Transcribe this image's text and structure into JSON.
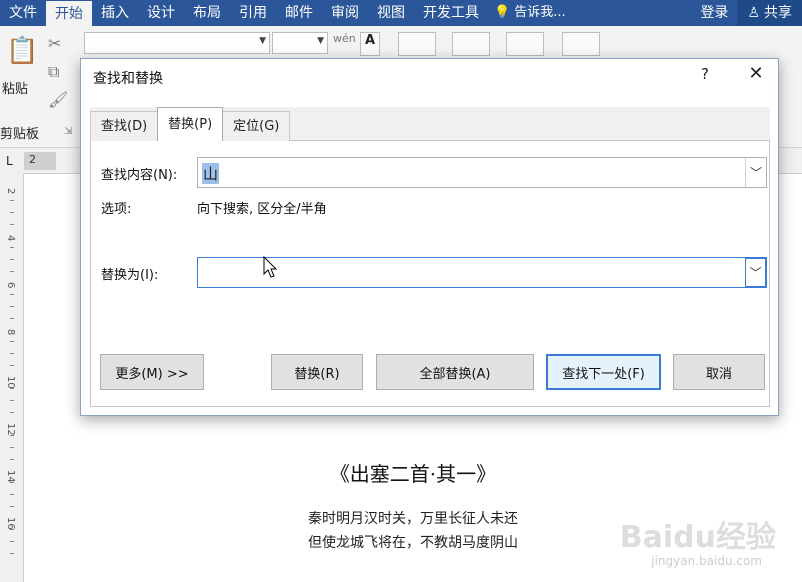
{
  "ribbon_tabs": [
    {
      "label": "文件",
      "active": false
    },
    {
      "label": "开始",
      "active": true
    },
    {
      "label": "插入",
      "active": false
    },
    {
      "label": "设计",
      "active": false
    },
    {
      "label": "布局",
      "active": false
    },
    {
      "label": "引用",
      "active": false
    },
    {
      "label": "邮件",
      "active": false
    },
    {
      "label": "审阅",
      "active": false
    },
    {
      "label": "视图",
      "active": false
    },
    {
      "label": "开发工具",
      "active": false
    }
  ],
  "tell_me": "告诉我...",
  "login": "登录",
  "share": "共享",
  "ribbon": {
    "paste_label": "粘贴",
    "clipboard_group": "剪贴板",
    "ruler_number": "2",
    "ruler_corner": "L"
  },
  "dialog": {
    "title": "查找和替换",
    "help": "?",
    "close": "✕",
    "tabs": [
      {
        "label": "查找(D)",
        "active": false
      },
      {
        "label": "替换(P)",
        "active": true
      },
      {
        "label": "定位(G)",
        "active": false
      }
    ],
    "find_label": "查找内容(N):",
    "find_value": "山",
    "options_label": "选项:",
    "options_value": "向下搜索, 区分全/半角",
    "replace_label": "替换为(I):",
    "replace_value": "",
    "buttons": {
      "more": "更多(M) >>",
      "replace": "替换(R)",
      "replace_all": "全部替换(A)",
      "find_next": "查找下一处(F)",
      "cancel": "取消"
    }
  },
  "document": {
    "title": "《出塞二首·其一》",
    "lines": [
      "秦时明月汉时关，万里长征人未还",
      "但使龙城飞将在，不教胡马度阴山"
    ]
  },
  "watermark": {
    "brand": "Baidu经验",
    "url": "jingyan.baidu.com"
  },
  "ruler_marks": [
    "2",
    "4",
    "6",
    "8",
    "10",
    "12",
    "14",
    "16"
  ]
}
